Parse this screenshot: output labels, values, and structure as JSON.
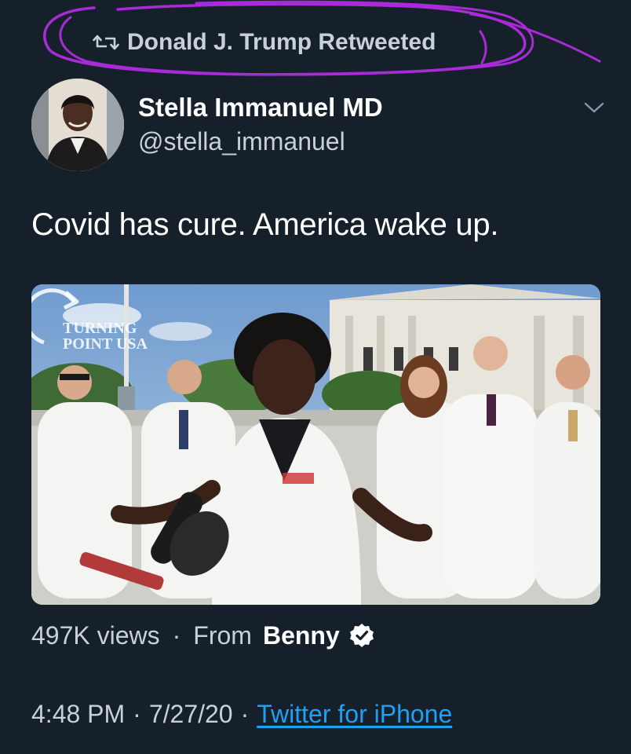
{
  "retweet": {
    "icon": "retweet-icon",
    "text": "Donald J. Trump Retweeted",
    "annotation_color": "#a72bd6"
  },
  "author": {
    "name": "Stella Immanuel MD",
    "handle": "@stella_immanuel",
    "avatar_icon": "avatar-photo",
    "menu_icon": "chevron-down-icon"
  },
  "tweet": {
    "text": "Covid has cure. America wake up."
  },
  "media": {
    "type": "video-thumbnail",
    "watermark_line1": "TURNING",
    "watermark_line2": "POINT USA"
  },
  "stats": {
    "views": "497K views",
    "separator": "·",
    "from_label": "From",
    "source_name": "Benny",
    "verified_icon": "verified-badge-icon"
  },
  "meta": {
    "time": "4:48 PM",
    "date": "7/27/20",
    "separator": "·",
    "client": "Twitter for iPhone"
  },
  "colors": {
    "background": "#15202b",
    "secondary_text": "#c8d0d8",
    "link": "#1da1f2"
  }
}
